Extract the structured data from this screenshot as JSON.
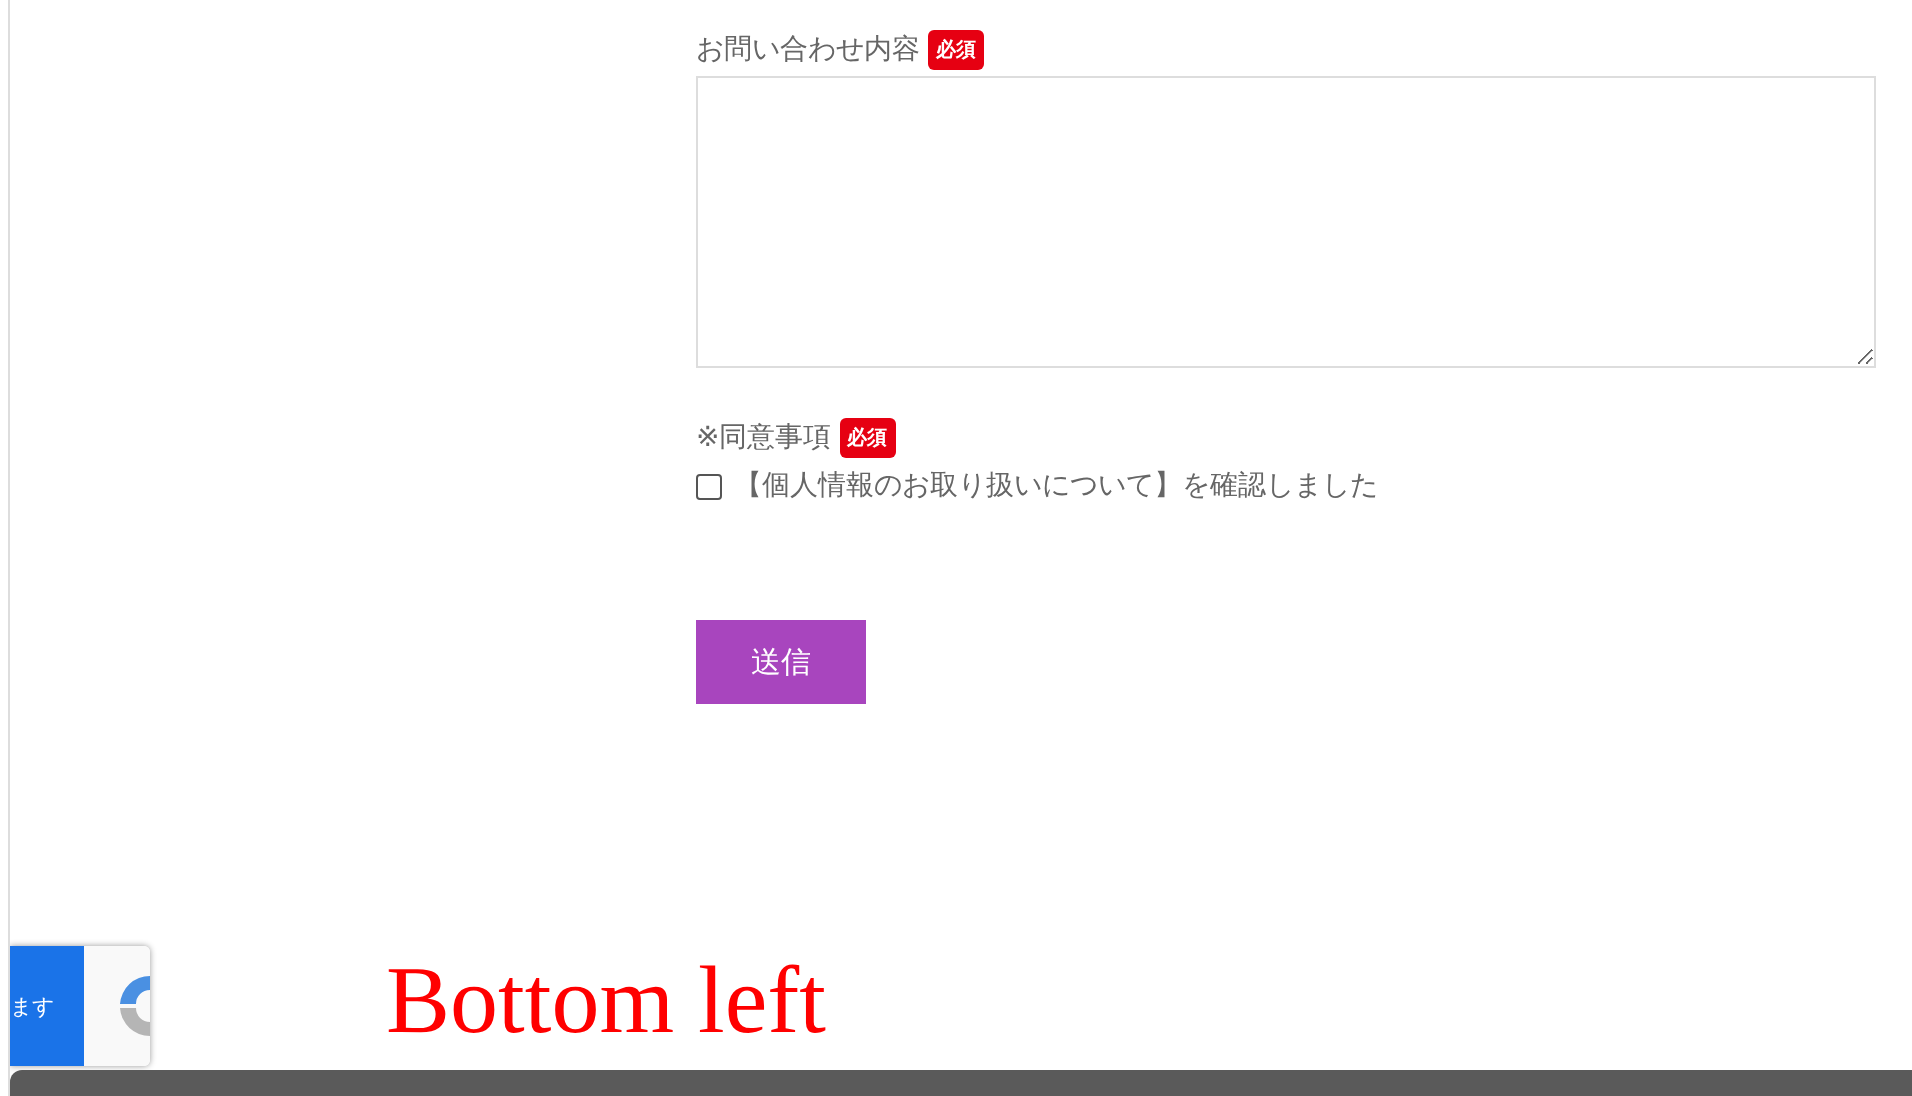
{
  "inquiry": {
    "label": "お問い合わせ内容",
    "badge": "必須"
  },
  "consent": {
    "label": "※同意事項",
    "badge": "必須",
    "checkbox": {
      "label": "【個人情報のお取り扱いについて】を確認しました",
      "checked": false
    }
  },
  "submit": "送信",
  "recaptcha": {
    "text": "ます"
  },
  "caption": "Bottom left"
}
